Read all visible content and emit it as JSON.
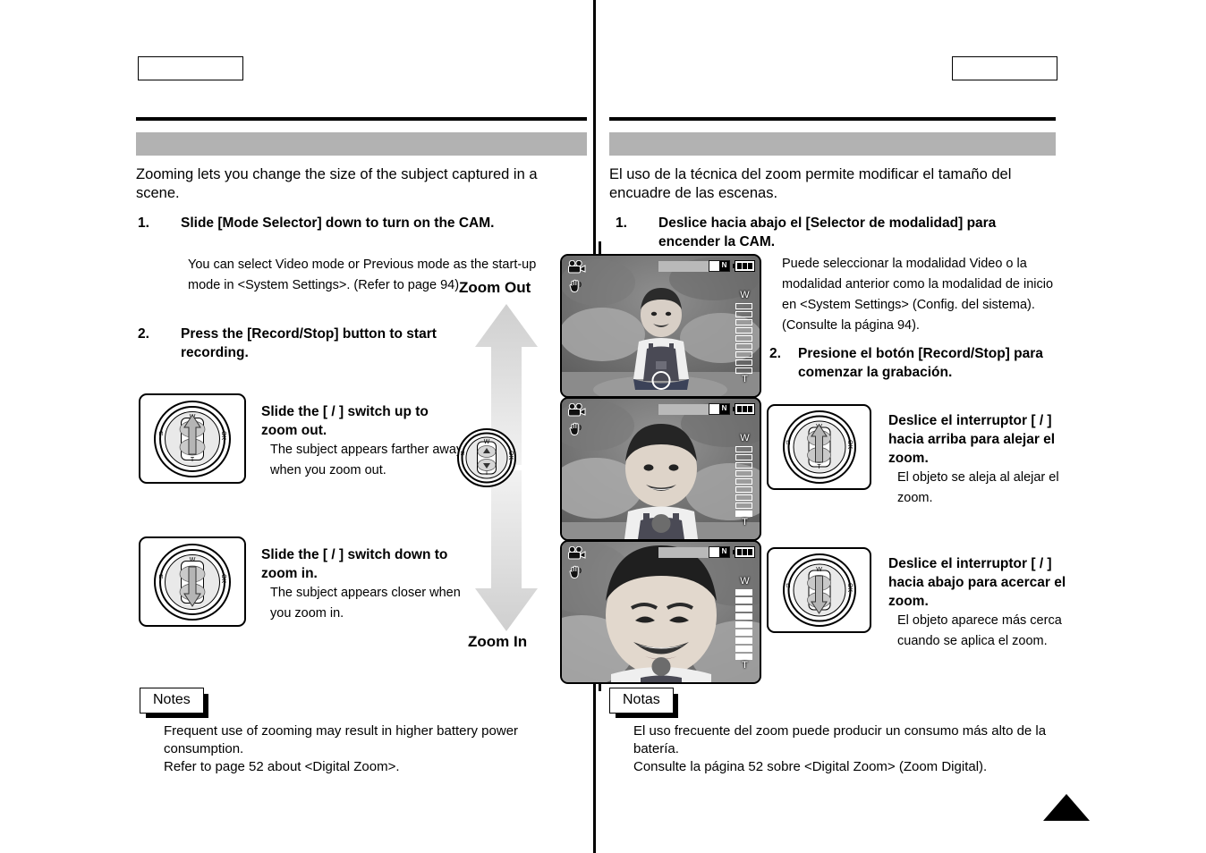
{
  "document": {
    "type": "camcorder-user-manual-page",
    "languages": [
      "English",
      "Spanish"
    ]
  },
  "left_column": {
    "header_box_text": "",
    "title_bar_text": "",
    "intro": "Zooming lets you change the size of the subject captured in a scene.",
    "steps": [
      {
        "num": "1.",
        "text": "Slide [Mode Selector] down to turn on the CAM."
      },
      {
        "num": "2.",
        "text": "Press the [Record/Stop] button to start recording."
      }
    ],
    "substep_1": "You can select Video mode or Previous mode as the start-up mode in <System Settings>. (Refer to page 94)",
    "instructions": [
      {
        "heading": "Slide the [    /    ] switch up to zoom out.",
        "body": "The subject appears farther away when you zoom out."
      },
      {
        "heading": "Slide the [    /    ] switch down to zoom in.",
        "body": "The subject appears closer when you zoom in."
      }
    ],
    "notes": {
      "label": "Notes",
      "lines": [
        "Frequent use of zooming may result in higher battery power consumption.",
        "Refer to page 52 about <Digital Zoom>."
      ]
    }
  },
  "right_column": {
    "header_box_text": "",
    "title_bar_text": "",
    "intro": "El uso de la técnica del zoom permite modificar el tamaño del encuadre de las escenas.",
    "steps": [
      {
        "num": "1.",
        "text": "Deslice hacia abajo el [Selector de modalidad] para encender la CAM."
      },
      {
        "num": "2.",
        "text": "Presione el botón [Record/Stop] para comenzar la grabación."
      }
    ],
    "substep_1": "Puede seleccionar la modalidad Video o la modalidad anterior como la modalidad de inicio en <System Settings> (Config. del sistema). (Consulte la página 94).",
    "instructions": [
      {
        "heading": "Deslice el interruptor [    /    ] hacia arriba para alejar el zoom.",
        "body": "El objeto se aleja al alejar el zoom."
      },
      {
        "heading": "Deslice el interruptor [    /    ] hacia abajo para acercar el zoom.",
        "body": "El objeto aparece más cerca cuando se aplica el zoom."
      }
    ],
    "notes": {
      "label": "Notas",
      "lines": [
        "El uso frecuente del zoom puede producir un consumo más alto de la batería.",
        "Consulte la página 52 sobre <Digital Zoom> (Zoom Digital)."
      ]
    }
  },
  "zoom_axis": {
    "top_label": "Zoom Out",
    "bottom_label": "Zoom In"
  },
  "joystick": {
    "label_w": "W",
    "label_t": "T",
    "label_ok": "OK",
    "label_menu": "⊐"
  },
  "lcd_screens": [
    {
      "name": "wide-view",
      "zoom_segments_total": 9,
      "zoom_segments_filled": 0,
      "label_w": "W",
      "label_t": "T",
      "card_label": "N",
      "rec_indicator": "ring"
    },
    {
      "name": "mid-view",
      "zoom_segments_total": 9,
      "zoom_segments_filled": 1,
      "label_w": "W",
      "label_t": "T",
      "card_label": "N",
      "rec_indicator": "filled"
    },
    {
      "name": "tele-view",
      "zoom_segments_total": 9,
      "zoom_segments_filled": 9,
      "label_w": "W",
      "label_t": "T",
      "card_label": "N",
      "rec_indicator": "filled"
    }
  ],
  "colors": {
    "title_bar_gray": "#b2b2b2",
    "rule_black": "#000000",
    "arrow_gray": "#d2d2d2"
  }
}
